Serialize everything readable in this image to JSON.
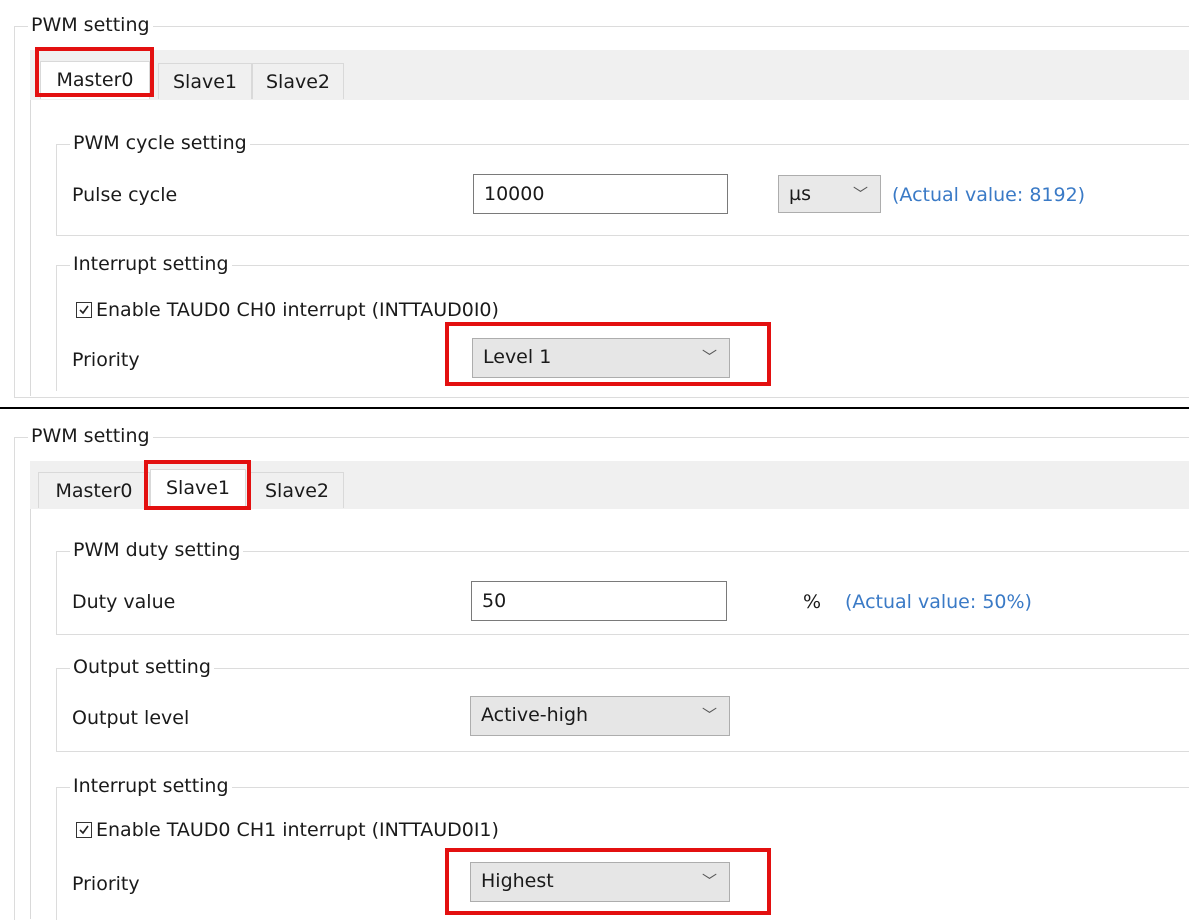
{
  "panel1": {
    "group_title": "PWM setting",
    "tabs": [
      "Master0",
      "Slave1",
      "Slave2"
    ],
    "active_tab": "Master0",
    "cycle_group": {
      "title": "PWM cycle setting",
      "pulse_cycle_label": "Pulse cycle",
      "pulse_cycle_value": "10000",
      "unit_value": "µs",
      "actual_value_text": "(Actual value: 8192)"
    },
    "interrupt_group": {
      "title": "Interrupt setting",
      "enable_label": "Enable TAUD0 CH0 interrupt (INTTAUD0I0)",
      "enable_checked": true,
      "priority_label": "Priority",
      "priority_value": "Level 1"
    }
  },
  "panel2": {
    "group_title": "PWM setting",
    "tabs": [
      "Master0",
      "Slave1",
      "Slave2"
    ],
    "active_tab": "Slave1",
    "duty_group": {
      "title": "PWM duty setting",
      "duty_label": "Duty value",
      "duty_value": "50",
      "unit_text": "%",
      "actual_value_text": "(Actual value: 50%)"
    },
    "output_group": {
      "title": "Output setting",
      "output_level_label": "Output level",
      "output_level_value": "Active-high"
    },
    "interrupt_group": {
      "title": "Interrupt setting",
      "enable_label": "Enable TAUD0 CH1 interrupt (INTTAUD0I1)",
      "enable_checked": true,
      "priority_label": "Priority",
      "priority_value": "Highest"
    }
  },
  "colors": {
    "highlight": "#e31010",
    "link": "#3a7ac6",
    "tab_bg": "#f0f0f0",
    "combo_bg": "#e6e6e6"
  },
  "icons": {
    "dropdown": "chevron-down-icon",
    "checkbox": "checkmark-icon"
  }
}
